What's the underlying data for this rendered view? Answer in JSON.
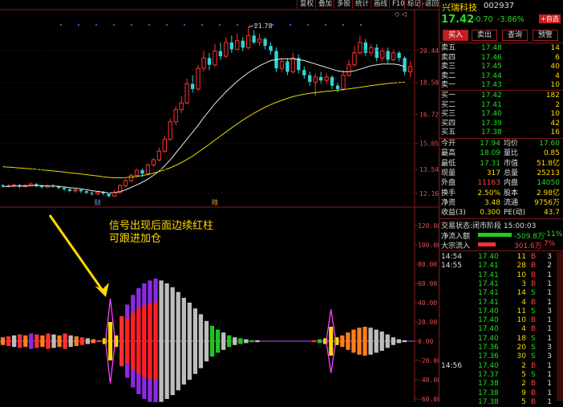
{
  "toolbar": {
    "items": [
      "复权",
      "叠加",
      "多股",
      "统计",
      "画线",
      "F10",
      "标记",
      "-",
      "返回"
    ]
  },
  "chart_labels": {
    "peak": "21.78",
    "marker_left": "财",
    "marker_mid": "除",
    "annotation_line1": "信号出现后面边续红柱",
    "annotation_line2": "可跟进加仓"
  },
  "chart_data": [
    {
      "type": "candlestick",
      "y_ticks": [
        "20.44",
        "18.58",
        "16.72",
        "15.05",
        "13.54",
        "12.16"
      ],
      "peak_label": "21.78",
      "candles": [
        [
          12.62,
          12.58,
          12.7,
          12.5
        ],
        [
          12.58,
          12.6,
          12.7,
          12.5
        ],
        [
          12.6,
          12.64,
          12.72,
          12.52
        ],
        [
          12.64,
          12.55,
          12.7,
          12.45
        ],
        [
          12.55,
          12.62,
          12.68,
          12.5
        ],
        [
          12.62,
          12.7,
          12.8,
          12.58
        ],
        [
          12.7,
          12.6,
          12.75,
          12.5
        ],
        [
          12.6,
          12.52,
          12.65,
          12.42
        ],
        [
          12.52,
          12.6,
          12.68,
          12.45
        ],
        [
          12.6,
          12.56,
          12.7,
          12.48
        ],
        [
          12.56,
          12.48,
          12.62,
          12.38
        ],
        [
          12.48,
          12.4,
          12.55,
          12.3
        ],
        [
          12.4,
          12.3,
          12.46,
          12.22
        ],
        [
          12.3,
          12.36,
          12.44,
          12.2
        ],
        [
          12.36,
          12.28,
          12.4,
          12.18
        ],
        [
          12.28,
          12.2,
          12.34,
          12.1
        ],
        [
          12.2,
          12.12,
          12.26,
          12.02
        ],
        [
          12.12,
          12.22,
          12.3,
          12.05
        ],
        [
          12.22,
          12.14,
          12.28,
          12.05
        ],
        [
          12.14,
          12.0,
          12.2,
          11.92
        ],
        [
          12.0,
          12.2,
          12.35,
          11.95
        ],
        [
          12.2,
          12.6,
          12.7,
          12.15
        ],
        [
          12.6,
          12.9,
          13.0,
          12.5
        ],
        [
          12.9,
          13.2,
          13.3,
          12.8
        ],
        [
          13.2,
          13.5,
          13.6,
          13.1
        ],
        [
          13.5,
          13.3,
          13.6,
          13.1
        ],
        [
          13.3,
          13.8,
          13.9,
          13.2
        ],
        [
          13.8,
          14.1,
          14.2,
          13.7
        ],
        [
          14.1,
          14.6,
          14.8,
          14.0
        ],
        [
          14.6,
          15.3,
          15.5,
          14.5
        ],
        [
          15.3,
          16.3,
          16.5,
          15.2
        ],
        [
          16.3,
          17.0,
          17.2,
          16.1
        ],
        [
          17.0,
          17.4,
          17.8,
          16.8
        ],
        [
          17.4,
          18.5,
          18.8,
          17.3
        ],
        [
          18.5,
          18.2,
          19.0,
          18.0
        ],
        [
          18.2,
          19.4,
          19.6,
          18.1
        ],
        [
          19.4,
          20.0,
          20.4,
          19.2
        ],
        [
          20.0,
          19.6,
          20.3,
          19.3
        ],
        [
          19.6,
          20.4,
          20.8,
          19.5
        ],
        [
          20.4,
          20.1,
          20.9,
          19.9
        ],
        [
          20.1,
          20.9,
          21.2,
          20.0
        ],
        [
          20.9,
          20.5,
          21.3,
          20.3
        ],
        [
          20.5,
          21.0,
          21.4,
          20.4
        ],
        [
          21.0,
          20.6,
          21.2,
          20.4
        ],
        [
          20.6,
          21.3,
          21.78,
          20.5
        ],
        [
          21.3,
          20.9,
          21.6,
          20.8
        ],
        [
          20.9,
          21.1,
          21.4,
          20.7
        ],
        [
          21.1,
          20.7,
          21.2,
          20.5
        ],
        [
          20.7,
          20.4,
          20.9,
          20.2
        ],
        [
          20.4,
          19.4,
          20.6,
          19.2
        ],
        [
          19.4,
          19.8,
          20.0,
          19.2
        ],
        [
          19.8,
          19.2,
          20.0,
          19.0
        ],
        [
          19.2,
          20.0,
          20.3,
          19.1
        ],
        [
          20.0,
          19.3,
          20.2,
          19.1
        ],
        [
          19.3,
          19.0,
          19.5,
          18.8
        ],
        [
          19.0,
          18.6,
          19.2,
          18.4
        ],
        [
          18.6,
          18.9,
          19.1,
          17.8
        ],
        [
          18.9,
          18.7,
          19.2,
          18.5
        ],
        [
          18.7,
          18.9,
          19.1,
          18.5
        ],
        [
          18.9,
          18.4,
          19.0,
          18.2
        ],
        [
          18.4,
          18.2,
          18.6,
          18.0
        ],
        [
          18.2,
          19.0,
          19.3,
          18.1
        ],
        [
          19.0,
          19.6,
          19.9,
          18.9
        ],
        [
          19.6,
          20.3,
          20.7,
          19.5
        ],
        [
          20.3,
          20.9,
          21.3,
          20.2
        ],
        [
          20.9,
          20.3,
          21.1,
          20.1
        ],
        [
          20.3,
          20.6,
          20.8,
          20.1
        ],
        [
          20.6,
          20.0,
          20.8,
          19.8
        ],
        [
          20.0,
          20.4,
          20.6,
          19.8
        ],
        [
          20.4,
          19.9,
          20.6,
          19.7
        ],
        [
          19.9,
          20.3,
          20.5,
          19.8
        ],
        [
          20.3,
          20.0,
          20.4,
          19.8
        ],
        [
          20.0,
          19.2,
          20.1,
          19.0
        ],
        [
          19.2,
          19.5,
          19.8,
          18.9
        ]
      ],
      "ma_short": [
        12.55,
        12.56,
        12.58,
        12.58,
        12.58,
        12.6,
        12.61,
        12.6,
        12.59,
        12.58,
        12.56,
        12.53,
        12.49,
        12.46,
        12.42,
        12.37,
        12.31,
        12.27,
        12.23,
        12.18,
        12.2,
        12.26,
        12.36,
        12.5,
        12.65,
        12.8,
        12.98,
        13.2,
        13.45,
        13.75,
        14.1,
        14.5,
        14.9,
        15.3,
        15.7,
        16.1,
        16.55,
        16.95,
        17.35,
        17.7,
        18.05,
        18.35,
        18.65,
        18.9,
        19.15,
        19.35,
        19.55,
        19.7,
        19.85,
        19.9,
        19.95,
        19.95,
        19.95,
        19.9,
        19.85,
        19.75,
        19.65,
        19.55,
        19.45,
        19.35,
        19.25,
        19.2,
        19.2,
        19.25,
        19.35,
        19.45,
        19.55,
        19.6,
        19.65,
        19.65,
        19.65,
        19.6,
        19.5
      ],
      "ma_long": [
        13.7,
        13.68,
        13.66,
        13.63,
        13.6,
        13.58,
        13.55,
        13.52,
        13.49,
        13.46,
        13.43,
        13.39,
        13.35,
        13.32,
        13.28,
        13.24,
        13.2,
        13.16,
        13.12,
        13.08,
        13.06,
        13.06,
        13.07,
        13.1,
        13.14,
        13.19,
        13.25,
        13.33,
        13.42,
        13.52,
        13.64,
        13.78,
        13.94,
        14.12,
        14.32,
        14.54,
        14.77,
        15.0,
        15.24,
        15.48,
        15.72,
        15.95,
        16.18,
        16.4,
        16.6,
        16.8,
        16.98,
        17.15,
        17.3,
        17.43,
        17.55,
        17.66,
        17.76,
        17.84,
        17.9,
        17.95,
        17.99,
        18.03,
        18.07,
        18.1,
        18.13,
        18.17,
        18.21,
        18.25,
        18.3,
        18.35,
        18.4,
        18.44,
        18.48,
        18.52,
        18.55,
        18.58,
        18.6
      ]
    },
    {
      "type": "bar",
      "y_ticks": [
        "120.00",
        "100.00",
        "80.00",
        "60.00",
        "40.00",
        "20.00",
        "0.00",
        "-20.00",
        "-40.00",
        "-60.00"
      ],
      "signal_left": {
        "x_index": 19,
        "level": 20
      },
      "signal_right": {
        "x_index": 58,
        "level": 15
      },
      "bars": [
        [
          4,
          "#ff7f1a"
        ],
        [
          5,
          "#ff3030"
        ],
        [
          6,
          "#bdbdbd"
        ],
        [
          7,
          "#ff3030"
        ],
        [
          6,
          "#ff7f1a"
        ],
        [
          8,
          "#8a2be2"
        ],
        [
          7,
          "#ff3030"
        ],
        [
          6,
          "#ff7f1a"
        ],
        [
          8,
          "#ff3030"
        ],
        [
          7,
          "#bdbdbd"
        ],
        [
          6,
          "#ff7f1a"
        ],
        [
          8,
          "#ff3030"
        ],
        [
          6,
          "#bdbdbd"
        ],
        [
          5,
          "#ff7f1a"
        ],
        [
          4,
          "#ff3030"
        ],
        [
          3,
          "#bdbdbd"
        ],
        [
          2,
          "#ff7f1a"
        ],
        [
          1,
          "#ff3030"
        ],
        [
          3,
          "#ffd900"
        ],
        [
          0,
          "#000"
        ],
        [
          6,
          "#ffd900"
        ],
        [
          26,
          "#ff3030"
        ],
        [
          38,
          "#8a2be2"
        ],
        [
          48,
          "#8a2be2"
        ],
        [
          55,
          "#8a2be2"
        ],
        [
          60,
          "#8a2be2"
        ],
        [
          63,
          "#8a2be2"
        ],
        [
          65,
          "#8a2be2"
        ],
        [
          63,
          "#bdbdbd"
        ],
        [
          60,
          "#bdbdbd"
        ],
        [
          56,
          "#bdbdbd"
        ],
        [
          51,
          "#bdbdbd"
        ],
        [
          45,
          "#bdbdbd"
        ],
        [
          40,
          "#bdbdbd"
        ],
        [
          34,
          "#bdbdbd"
        ],
        [
          28,
          "#bdbdbd"
        ],
        [
          21,
          "#bdbdbd"
        ],
        [
          16,
          "#22c222"
        ],
        [
          12,
          "#22c222"
        ],
        [
          9,
          "#bdbdbd"
        ],
        [
          6,
          "#22c222"
        ],
        [
          4,
          "#bdbdbd"
        ],
        [
          3,
          "#22c222"
        ],
        [
          2,
          "#bdbdbd"
        ],
        [
          1,
          "#22c222"
        ],
        [
          1,
          "#bdbdbd"
        ],
        [
          0,
          "#000"
        ],
        [
          0,
          "#000"
        ],
        [
          0,
          "#000"
        ],
        [
          0,
          "#000"
        ],
        [
          0,
          "#000"
        ],
        [
          0,
          "#000"
        ],
        [
          0,
          "#000"
        ],
        [
          0,
          "#000"
        ],
        [
          0,
          "#000"
        ],
        [
          1,
          "#ff3030"
        ],
        [
          2,
          "#22c222"
        ],
        [
          3,
          "#ffd900"
        ],
        [
          0,
          "#000"
        ],
        [
          4,
          "#ffd900"
        ],
        [
          6,
          "#ff7f1a"
        ],
        [
          9,
          "#ff7f1a"
        ],
        [
          12,
          "#ff7f1a"
        ],
        [
          14,
          "#ff7f1a"
        ],
        [
          15,
          "#ff7f1a"
        ],
        [
          14,
          "#bdbdbd"
        ],
        [
          12,
          "#bdbdbd"
        ],
        [
          10,
          "#bdbdbd"
        ],
        [
          7,
          "#bdbdbd"
        ],
        [
          4,
          "#bdbdbd"
        ],
        [
          2,
          "#bdbdbd"
        ],
        [
          1,
          "#bdbdbd"
        ],
        [
          0,
          "#000"
        ]
      ]
    }
  ],
  "stock": {
    "name": "兴瑞科技",
    "code": "002937",
    "price": "17.42",
    "change": "-0.70",
    "pct": "-3.86%",
    "add_btn": "+自选"
  },
  "trade_buttons": [
    "买入",
    "卖出",
    "查询",
    "预警"
  ],
  "ask": [
    [
      "卖五",
      "17.48",
      "14"
    ],
    [
      "卖四",
      "17.46",
      "6"
    ],
    [
      "卖三",
      "17.45",
      "40"
    ],
    [
      "卖二",
      "17.44",
      "4"
    ],
    [
      "卖一",
      "17.43",
      "10"
    ]
  ],
  "bid": [
    [
      "买一",
      "17.42",
      "182"
    ],
    [
      "买二",
      "17.41",
      "2"
    ],
    [
      "买三",
      "17.40",
      "10"
    ],
    [
      "买四",
      "17.39",
      "42"
    ],
    [
      "买五",
      "17.38",
      "16"
    ]
  ],
  "stats": [
    [
      "今开",
      "17.94",
      "均价",
      "17.60"
    ],
    [
      "最高",
      "18.09",
      "量比",
      "0.85"
    ],
    [
      "最低",
      "17.31",
      "市值",
      "51.8亿"
    ],
    [
      "现量",
      "317",
      "总量",
      "25213"
    ],
    [
      "外盘",
      "11163",
      "内盘",
      "14050"
    ],
    [
      "换手",
      "2.50%",
      "股本",
      "2.98亿"
    ],
    [
      "净资",
      "3.48",
      "流通",
      "9756万"
    ],
    [
      "收益(3)",
      "0.300",
      "PE(动)",
      "43.7"
    ]
  ],
  "flow": {
    "status": "交易状态:闭市阶段 15:00:03",
    "net_label": "净流入额",
    "net_value": "-509.8万",
    "net_pct": "-11%",
    "big_label": "大宗流入",
    "big_value": "301.6万",
    "big_pct": "7%"
  },
  "ticks_col1": [
    [
      "14:54",
      "17.40",
      "11",
      "B",
      "3"
    ],
    [
      "14:55",
      "17.41",
      "28",
      "B",
      "2"
    ],
    [
      "",
      "17.41",
      "10",
      "B",
      "1"
    ],
    [
      "",
      "17.41",
      "3",
      "B",
      "1"
    ],
    [
      "",
      "17.41",
      "14",
      "S",
      "1"
    ],
    [
      "",
      "17.41",
      "4",
      "B",
      "1"
    ],
    [
      "",
      "17.40",
      "11",
      "S",
      "3"
    ],
    [
      "",
      "17.40",
      "10",
      "B",
      "1"
    ],
    [
      "",
      "17.40",
      "4",
      "B",
      "1"
    ],
    [
      "",
      "17.40",
      "18",
      "S",
      "1"
    ],
    [
      "",
      "17.36",
      "20",
      "S",
      "3"
    ],
    [
      "",
      "17.36",
      "30",
      "S",
      "3"
    ],
    [
      "14:56",
      "17.40",
      "2",
      "B",
      "1"
    ],
    [
      "",
      "17.37",
      "5",
      "S",
      "1"
    ],
    [
      "",
      "17.38",
      "2",
      "B",
      "1"
    ],
    [
      "",
      "17.38",
      "9",
      "B",
      "1"
    ],
    [
      "",
      "17.38",
      "5",
      "B",
      "1"
    ]
  ]
}
